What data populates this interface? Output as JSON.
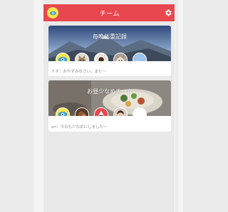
{
  "appbar": {
    "title": "チーム",
    "accent_color": "#e8474f",
    "avatar_icon": "eye-mascot-icon",
    "settings_icon": "gear-icon"
  },
  "teams": [
    {
      "name": "毎晩体重記録",
      "last_message": "ナオ：おやすみなさい。また～",
      "members": [
        "eye-mascot",
        "cat",
        "coffee",
        "dog",
        "sky"
      ]
    },
    {
      "name": "お昼少なめチーム",
      "last_message": "eri：今日も少なめにしました～",
      "members": [
        "eye-mascot",
        "food",
        "onigiri",
        "portrait",
        "blank"
      ]
    }
  ]
}
